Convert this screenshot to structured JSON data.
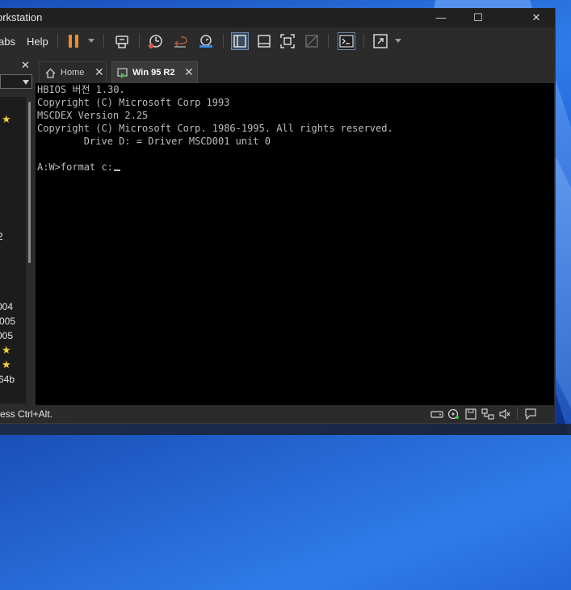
{
  "window": {
    "title": "orkstation",
    "minimize": "—",
    "maximize": "☐",
    "close": "✕"
  },
  "menu": {
    "tabs": "abs",
    "help": "Help"
  },
  "library": {
    "close": "✕",
    "items": [
      "004",
      "005",
      "005",
      "64b"
    ]
  },
  "tabs": [
    {
      "label": "Home",
      "close": "✕"
    },
    {
      "label": "Win 95 R2",
      "close": "✕"
    }
  ],
  "console": {
    "lines": [
      "HBIOS 버전 1.30.",
      "Copyright (C) Microsoft Corp 1993",
      "MSCDEX Version 2.25",
      "Copyright (C) Microsoft Corp. 1986-1995. All rights reserved.",
      "        Drive D: = Driver MSCD001 unit 0",
      "",
      "A:W>format c:"
    ]
  },
  "statusbar": {
    "text": "ress Ctrl+Alt."
  },
  "colors": {
    "accent": "#3a8be0",
    "pause": "#f28c2a"
  }
}
